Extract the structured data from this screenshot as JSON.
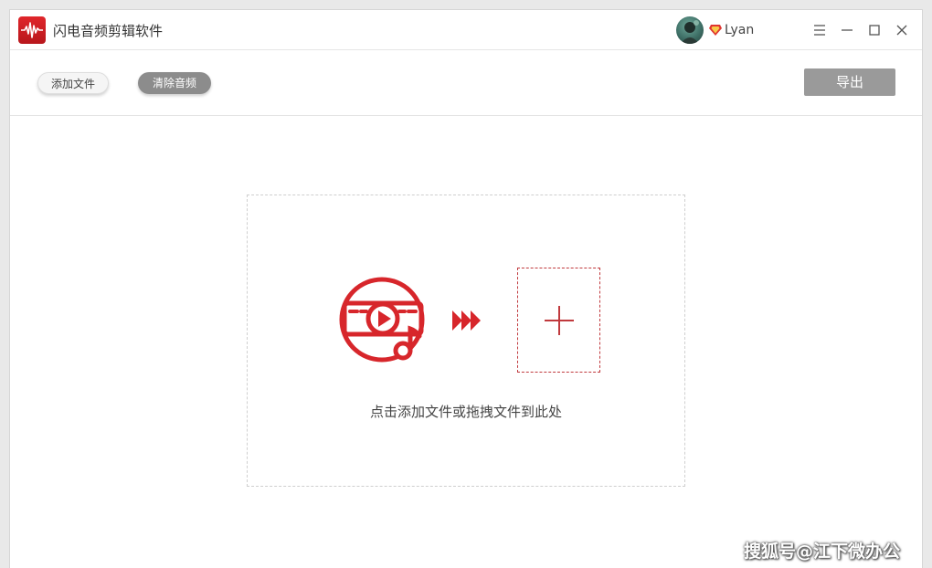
{
  "app": {
    "title": "闪电音频剪辑软件",
    "icon": "waveform-logo-icon",
    "accent": "#d7262b"
  },
  "user": {
    "name": "Lyan",
    "badge_icon": "vip-diamond-icon"
  },
  "window_controls": [
    "menu-icon",
    "minimize-icon",
    "maximize-icon",
    "close-icon"
  ],
  "toolbar": {
    "add_label": "添加文件",
    "clear_label": "清除音频",
    "export_label": "导出"
  },
  "dropzone": {
    "hint": "点击添加文件或拖拽文件到此处",
    "media_icon": "video-music-icon",
    "arrows_icon": "triple-arrow-icon",
    "add_icon": "plus-icon"
  },
  "watermark": "搜狐号@江下微办公"
}
